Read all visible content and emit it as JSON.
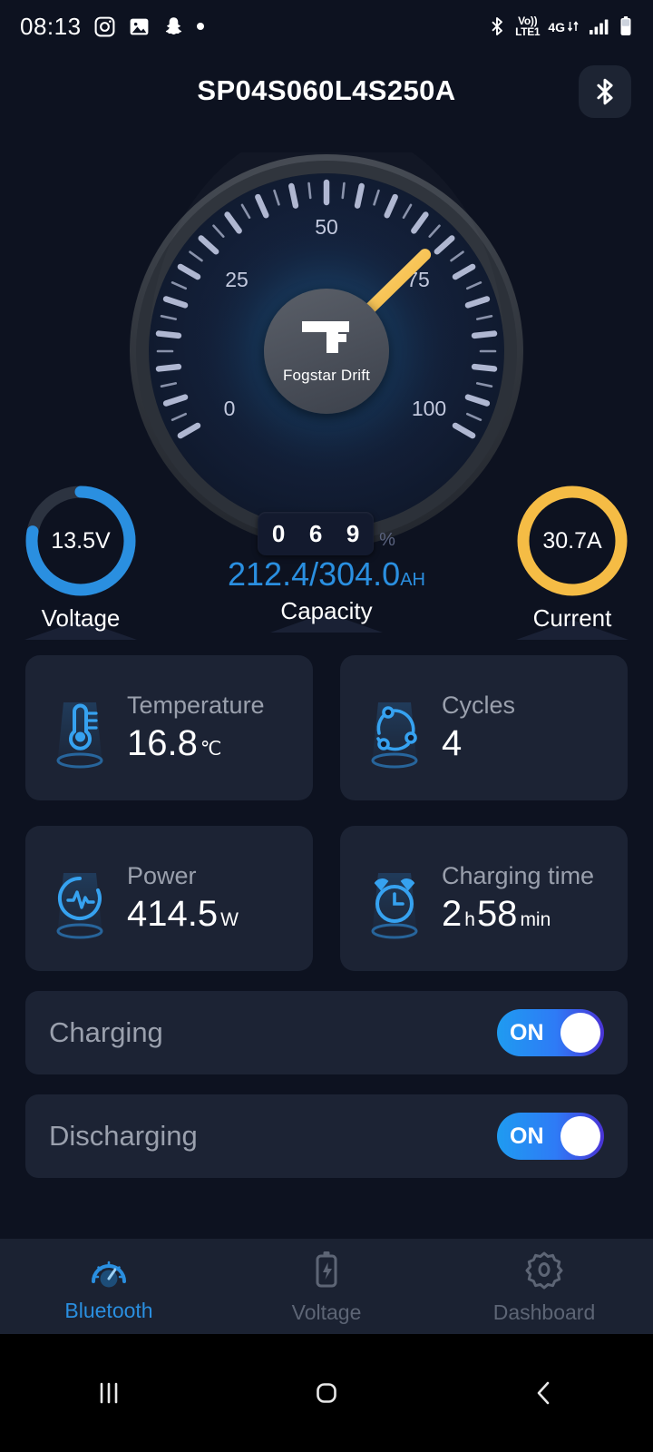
{
  "statusbar": {
    "time": "08:13",
    "left_icons": [
      "instagram-icon",
      "photos-icon",
      "snapchat-icon",
      "dot-icon"
    ],
    "volte_top": "Vo))",
    "volte_bottom": "LTE1",
    "network": "4G",
    "right_icons": [
      "bluetooth-icon",
      "volte-icon",
      "4g-icon",
      "signal-bars-icon",
      "battery-icon"
    ]
  },
  "header": {
    "title": "SP04S060L4S250A",
    "bluetooth_button": "bluetooth-icon"
  },
  "gauge": {
    "brand": "Fogstar Drift",
    "tick_labels": [
      "0",
      "25",
      "50",
      "75",
      "100"
    ],
    "percent_digits": [
      "0",
      "6",
      "9"
    ],
    "percent_symbol": "%",
    "value": 69,
    "min": 0,
    "max": 100,
    "needle_color": "#f5c35a"
  },
  "metrics": {
    "voltage": {
      "value": "13.5V",
      "label": "Voltage",
      "color": "#2a8fe0",
      "fill_pct": 78
    },
    "capacity": {
      "value": "212.4/304.0",
      "unit": "AH",
      "label": "Capacity",
      "color": "#2a8fe0"
    },
    "current": {
      "value": "30.7A",
      "label": "Current",
      "color": "#f5bc45",
      "fill_pct": 100
    }
  },
  "cards": [
    {
      "icon": "thermometer-icon",
      "title": "Temperature",
      "value": "16.8",
      "unit": "℃"
    },
    {
      "icon": "cycles-icon",
      "title": "Cycles",
      "value": "4",
      "unit": ""
    },
    {
      "icon": "power-pulse-icon",
      "title": "Power",
      "value": "414.5",
      "unit": "W"
    },
    {
      "icon": "alarm-clock-icon",
      "title": "Charging time",
      "value": "2",
      "unit": "h",
      "value2": "58",
      "unit2": "min"
    }
  ],
  "toggles": [
    {
      "label": "Charging",
      "state": "ON"
    },
    {
      "label": "Discharging",
      "state": "ON"
    }
  ],
  "bottomnav": [
    {
      "icon": "speedometer-icon",
      "label": "Bluetooth",
      "active": true
    },
    {
      "icon": "battery-bolt-icon",
      "label": "Voltage",
      "active": false
    },
    {
      "icon": "gear-icon",
      "label": "Dashboard",
      "active": false
    }
  ],
  "sysnav": [
    "recents-icon",
    "home-icon",
    "back-icon"
  ],
  "colors": {
    "background": "#0d1220",
    "card": "#1c2334",
    "accent_blue": "#2a8fe0",
    "accent_amber": "#f5bc45",
    "text_muted": "#9aa0ad"
  }
}
